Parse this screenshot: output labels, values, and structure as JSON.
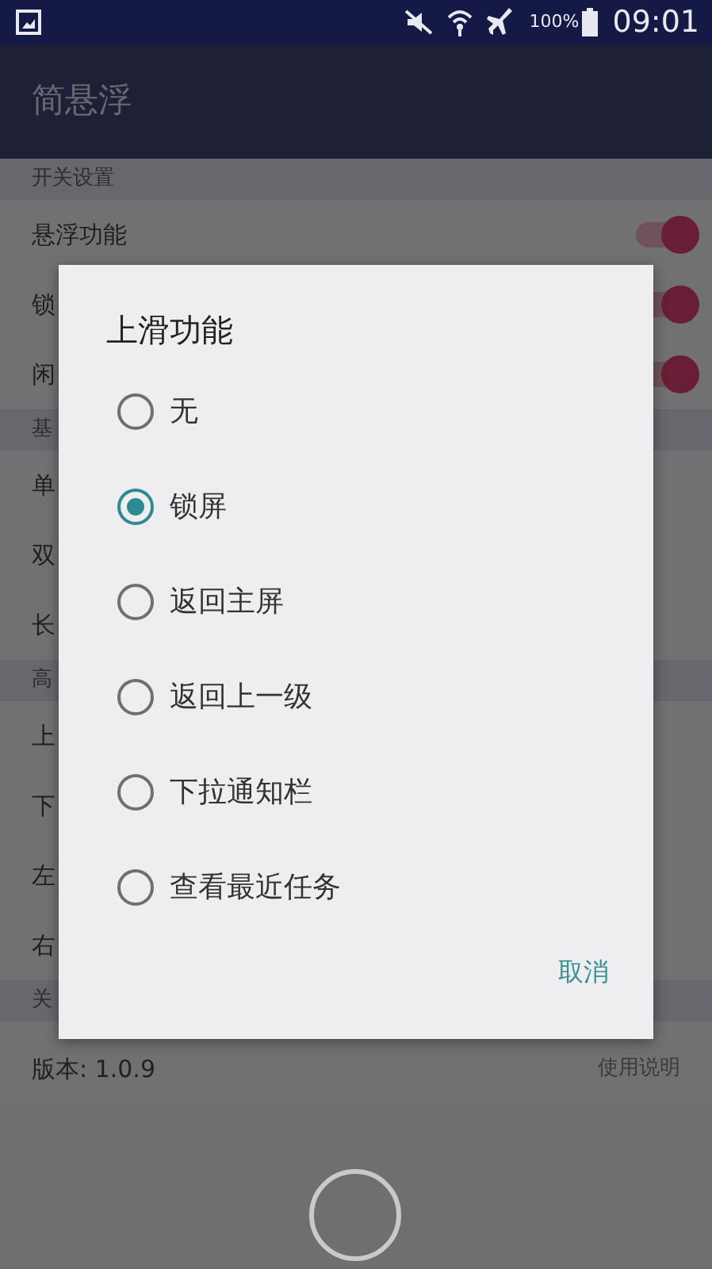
{
  "status_bar": {
    "battery": "100%",
    "time": "09:01"
  },
  "app_bar": {
    "title": "简悬浮"
  },
  "settings": [
    {
      "kind": "header",
      "label": "开关设置"
    },
    {
      "kind": "switch",
      "label": "悬浮功能",
      "on": true
    },
    {
      "kind": "switch",
      "label": "锁",
      "on": true
    },
    {
      "kind": "switch",
      "label": "闲",
      "on": true
    },
    {
      "kind": "header",
      "label": "基"
    },
    {
      "kind": "item",
      "label": "单"
    },
    {
      "kind": "item",
      "label": "双"
    },
    {
      "kind": "item",
      "label": "长"
    },
    {
      "kind": "header",
      "label": "高"
    },
    {
      "kind": "item",
      "label": "上"
    },
    {
      "kind": "item",
      "label": "下"
    },
    {
      "kind": "item",
      "label": "左"
    },
    {
      "kind": "item",
      "label": "右"
    },
    {
      "kind": "header",
      "label": "关"
    },
    {
      "kind": "item",
      "label": "版本: 1.0.9",
      "value": "使用说明"
    }
  ],
  "dialog": {
    "title": "上滑功能",
    "options": [
      {
        "label": "无",
        "selected": false
      },
      {
        "label": "锁屏",
        "selected": true
      },
      {
        "label": "返回主屏",
        "selected": false
      },
      {
        "label": "返回上一级",
        "selected": false
      },
      {
        "label": "下拉通知栏",
        "selected": false
      },
      {
        "label": "查看最近任务",
        "selected": false
      }
    ],
    "buttons": [
      "取消"
    ]
  }
}
